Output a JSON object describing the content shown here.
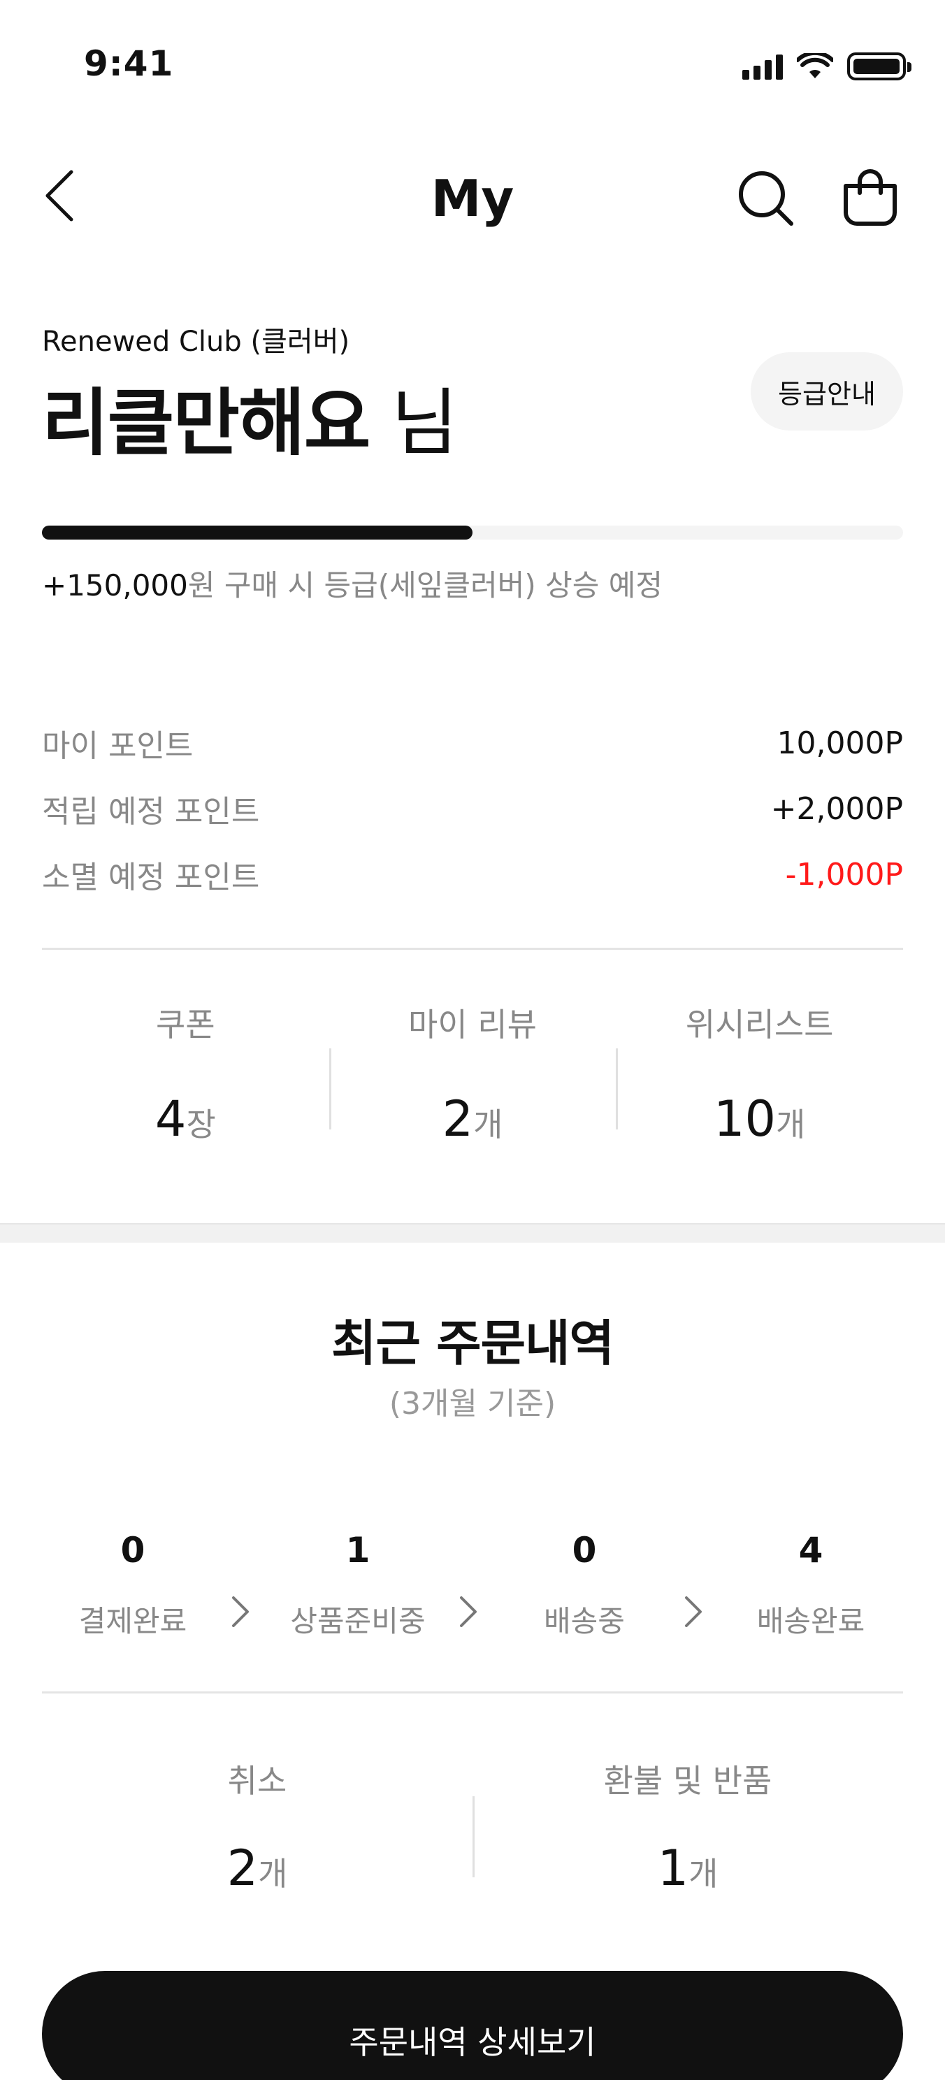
{
  "status_bar": {
    "time": "9:41"
  },
  "header": {
    "title": "My"
  },
  "profile": {
    "club": "Renewed Club (클러버)",
    "name": "리클만해요",
    "name_suffix": " 님",
    "grade_button": "등급안내",
    "progress_fraction": 0.5,
    "progress_amount": "+150,000",
    "progress_text": "원 구매 시 등급(세잎클러버) 상승 예정"
  },
  "points": [
    {
      "label": "마이 포인트",
      "value": "10,000P"
    },
    {
      "label": "적립 예정 포인트",
      "value": "+2,000P"
    },
    {
      "label": "소멸 예정 포인트",
      "value": "-1,000P"
    }
  ],
  "stats": [
    {
      "label": "쿠폰",
      "count": "4",
      "unit": "장"
    },
    {
      "label": "마이 리뷰",
      "count": "2",
      "unit": "개"
    },
    {
      "label": "위시리스트",
      "count": "10",
      "unit": "개"
    }
  ],
  "orders": {
    "title": "최근 주문내역",
    "subtitle": "(3개월 기준)",
    "steps": [
      {
        "count": "0",
        "label": "결제완료"
      },
      {
        "count": "1",
        "label": "상품준비중"
      },
      {
        "count": "0",
        "label": "배송중"
      },
      {
        "count": "4",
        "label": "배송완료"
      }
    ],
    "claims": [
      {
        "label": "취소",
        "count": "2",
        "unit": "개"
      },
      {
        "label": "환불 및 반품",
        "count": "1",
        "unit": "개"
      }
    ],
    "detail_button": "주문내역 상세보기"
  },
  "colors": {
    "accent": "#111111",
    "negative": "#ff1a1a",
    "muted": "#888888"
  }
}
